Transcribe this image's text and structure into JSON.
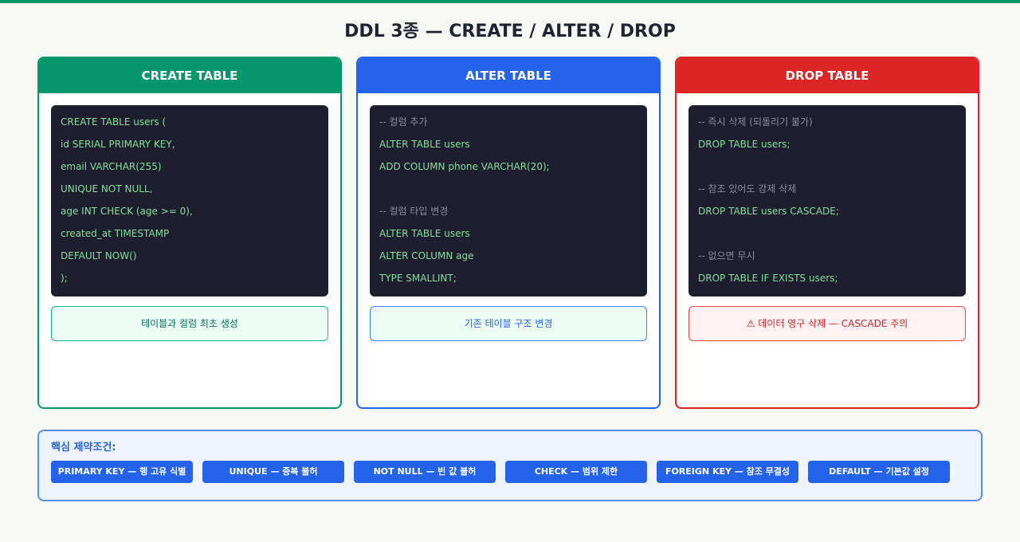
{
  "title": "DDL 3종 — CREATE / ALTER / DROP",
  "colors": {
    "create": "#059669",
    "alter": "#2563eb",
    "drop": "#dc2626",
    "code_bg": "#1e1e2e",
    "code_text": "#86e09a",
    "code_comment": "#8b8f9a"
  },
  "cards": [
    {
      "header": "CREATE TABLE",
      "code": [
        "CREATE TABLE users (",
        "id SERIAL PRIMARY KEY,",
        "email VARCHAR(255)",
        "UNIQUE NOT NULL,",
        "age INT CHECK (age >= 0),",
        "created_at TIMESTAMP",
        "DEFAULT NOW()",
        ");"
      ],
      "note": "테이블과 컬럼 최초 생성"
    },
    {
      "header": "ALTER TABLE",
      "code": [
        "-- 컬럼 추가",
        "ALTER TABLE users",
        "ADD COLUMN phone VARCHAR(20);",
        "",
        "-- 컬럼 타입 변경",
        "ALTER TABLE users",
        "ALTER COLUMN age",
        "TYPE SMALLINT;"
      ],
      "note": "기존 테이블 구조 변경"
    },
    {
      "header": "DROP TABLE",
      "code": [
        "-- 즉시 삭제 (되돌리기 불가)",
        "DROP TABLE users;",
        "",
        "-- 참조 있어도 강제 삭제",
        "DROP TABLE users CASCADE;",
        "",
        "-- 없으면 무시",
        "DROP TABLE IF EXISTS users;"
      ],
      "note": "⚠ 데이터 영구 삭제 — CASCADE 주의"
    }
  ],
  "constraints": {
    "title": "핵심 제약조건:",
    "items": [
      "PRIMARY KEY — 행 고유 식별",
      "UNIQUE — 중복 불허",
      "NOT NULL — 빈 값 불허",
      "CHECK — 범위 제한",
      "FOREIGN KEY — 참조 무결성",
      "DEFAULT — 기본값 설정"
    ]
  }
}
